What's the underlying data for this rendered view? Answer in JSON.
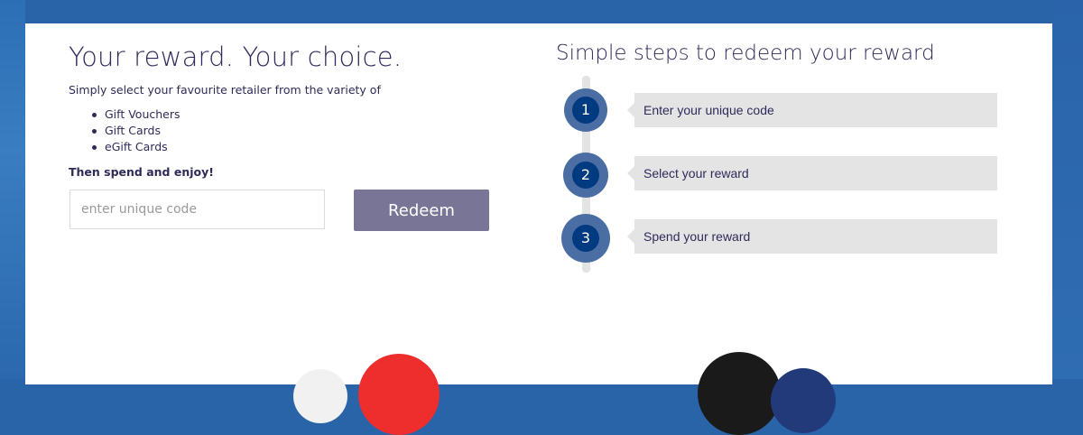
{
  "left": {
    "headline": "Your reward. Your choice.",
    "intro": "Simply select your favourite retailer from the variety of",
    "options": [
      "Gift Vouchers",
      "Gift Cards",
      "eGift Cards"
    ],
    "cta_text": "Then spend and enjoy!",
    "code_input": {
      "value": "",
      "placeholder": "enter unique code"
    },
    "redeem_label": "Redeem"
  },
  "right": {
    "title": "Simple steps to redeem your reward",
    "steps": [
      {
        "number": "1",
        "text": "Enter your unique code"
      },
      {
        "number": "2",
        "text": "Select your reward"
      },
      {
        "number": "3",
        "text": "Spend your reward"
      }
    ]
  },
  "colors": {
    "background_blue": "#2a64a8",
    "text_navy": "#2e2b5a",
    "redeem_button": "#787597",
    "step_circle_outer": "#4a6ea3",
    "step_circle_inner": "#003a80",
    "step_box": "#e4e4e4"
  }
}
